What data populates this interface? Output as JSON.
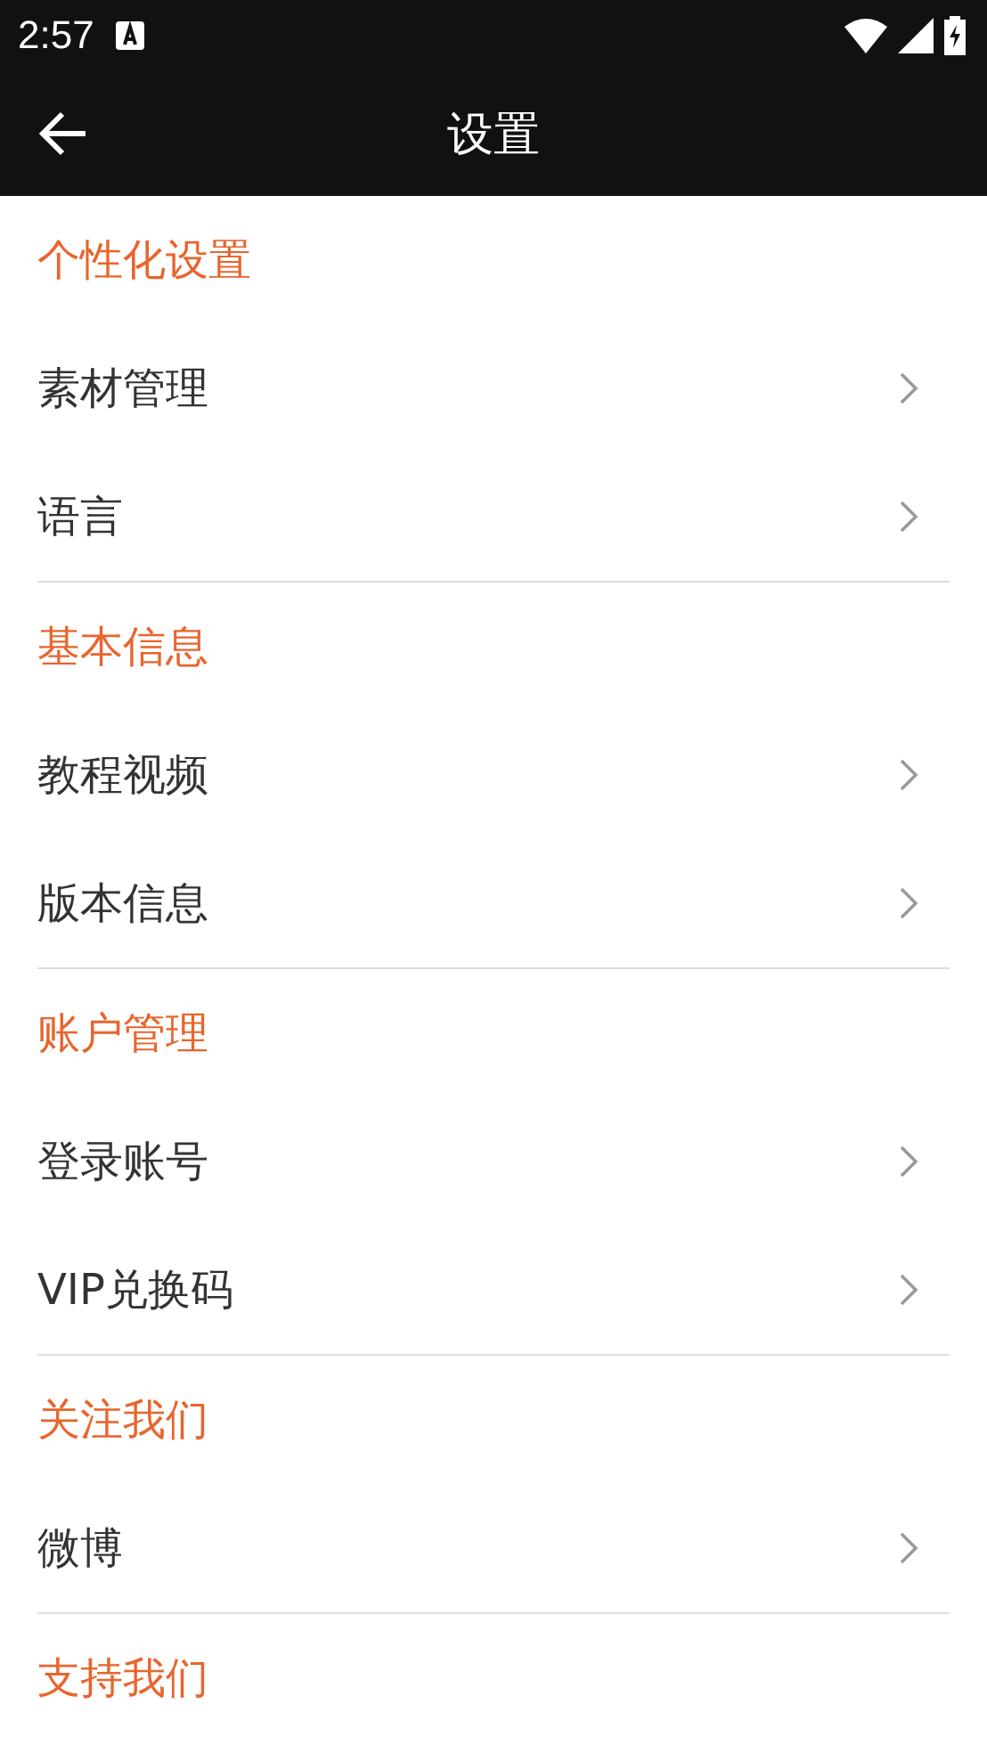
{
  "status_bar": {
    "time": "2:57"
  },
  "app_bar": {
    "title": "设置"
  },
  "sections": [
    {
      "title": "个性化设置",
      "items": [
        {
          "label": "素材管理"
        },
        {
          "label": "语言"
        }
      ]
    },
    {
      "title": "基本信息",
      "items": [
        {
          "label": "教程视频"
        },
        {
          "label": "版本信息"
        }
      ]
    },
    {
      "title": "账户管理",
      "items": [
        {
          "label": "登录账号"
        },
        {
          "label": "VIP兑换码"
        }
      ]
    },
    {
      "title": "关注我们",
      "items": [
        {
          "label": "微博"
        }
      ]
    },
    {
      "title": "支持我们"
    }
  ]
}
